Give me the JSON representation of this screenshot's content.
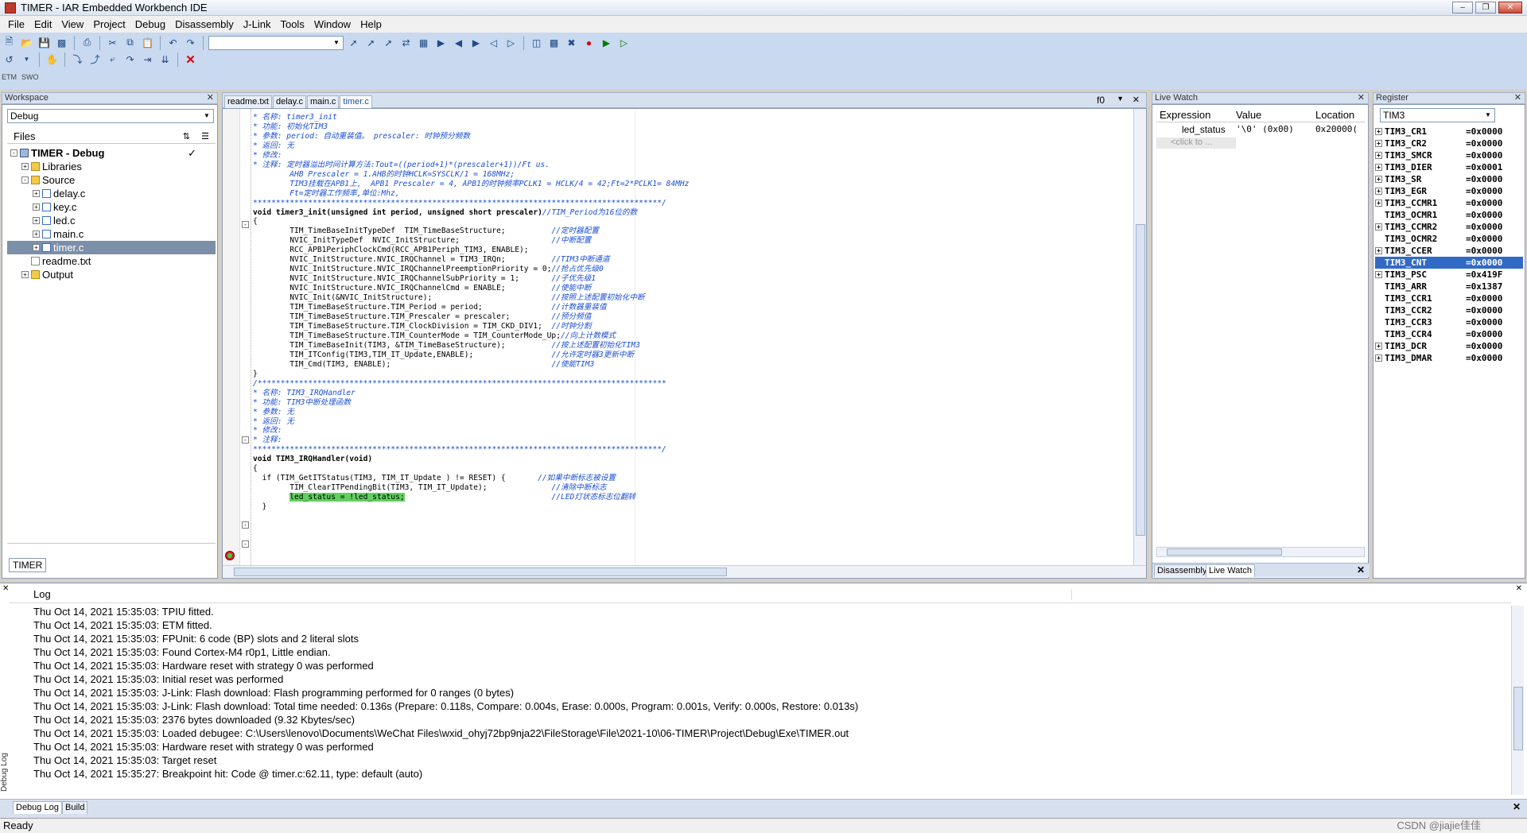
{
  "window": {
    "title": "TIMER - IAR Embedded Workbench IDE"
  },
  "menu": [
    "File",
    "Edit",
    "View",
    "Project",
    "Debug",
    "Disassembly",
    "J-Link",
    "Tools",
    "Window",
    "Help"
  ],
  "small_toolbar_labels": [
    "ETM",
    "SWO"
  ],
  "workspace": {
    "header": "Workspace",
    "config": "Debug",
    "files_label": "Files",
    "tree": [
      {
        "label": "TIMER - Debug",
        "level": 0,
        "kind": "project",
        "check": "✓"
      },
      {
        "label": "Libraries",
        "level": 1,
        "kind": "folder"
      },
      {
        "label": "Source",
        "level": 1,
        "kind": "folder"
      },
      {
        "label": "delay.c",
        "level": 2,
        "kind": "c"
      },
      {
        "label": "key.c",
        "level": 2,
        "kind": "c"
      },
      {
        "label": "led.c",
        "level": 2,
        "kind": "c"
      },
      {
        "label": "main.c",
        "level": 2,
        "kind": "c"
      },
      {
        "label": "timer.c",
        "level": 2,
        "kind": "c",
        "selected": true
      },
      {
        "label": "readme.txt",
        "level": 1,
        "kind": "txt"
      },
      {
        "label": "Output",
        "level": 1,
        "kind": "folder"
      }
    ],
    "bottom_tab": "TIMER"
  },
  "editor": {
    "tabs": [
      "readme.txt",
      "delay.c",
      "main.c",
      "timer.c"
    ],
    "active_tab": "timer.c",
    "func_dropdown": "f0",
    "lines": [
      "* 名称: timer3_init",
      "* 功能: 初始化TIM3",
      "* 参数: period: 自动重装值。 prescaler: 时钟预分频数",
      "* 返回: 无",
      "* 修改:",
      "* 注释: 定时器溢出时间计算方法:Tout=((period+1)*(prescaler+1))/Ft us.",
      "        AHB Prescaler = 1.AHB的时钟HCLK=SYSCLK/1 = 168MHz;",
      "        TIM3挂载在APB1上,  APB1 Prescaler = 4, APB1的时钟频率PCLK1 = HCLK/4 = 42;Ft=2*PCLK1= 84MHz",
      "        Ft=定时器工作频率,单位:Mhz,",
      "*****************************************************************************************/",
      "void timer3_init(unsigned int period, unsigned short prescaler)//TIM_Period为16位的数",
      "{",
      "",
      "        TIM_TimeBaseInitTypeDef  TIM_TimeBaseStructure;          //定时器配置",
      "        NVIC_InitTypeDef  NVIC_InitStructure;                    //中断配置",
      "",
      "        RCC_APB1PeriphClockCmd(RCC_APB1Periph_TIM3, ENABLE);",
      "        NVIC_InitStructure.NVIC_IRQChannel = TIM3_IRQn;          //TIM3中断通道",
      "        NVIC_InitStructure.NVIC_IRQChannelPreemptionPriority = 0;//抢占优先级0",
      "        NVIC_InitStructure.NVIC_IRQChannelSubPriority = 1;       //子优先级1",
      "        NVIC_InitStructure.NVIC_IRQChannelCmd = ENABLE;          //使能中断",
      "",
      "        NVIC_Init(&NVIC_InitStructure);                          //按照上述配置初始化中断",
      "",
      "        TIM_TimeBaseStructure.TIM_Period = period;               //计数器重装值",
      "        TIM_TimeBaseStructure.TIM_Prescaler = prescaler;         //预分频值",
      "        TIM_TimeBaseStructure.TIM_ClockDivision = TIM_CKD_DIV1;  //时钟分割",
      "        TIM_TimeBaseStructure.TIM_CounterMode = TIM_CounterMode_Up;//向上计数模式",
      "        TIM_TimeBaseInit(TIM3, &TIM_TimeBaseStructure);          //按上述配置初始化TIM3",
      "",
      "        TIM_ITConfig(TIM3,TIM_IT_Update,ENABLE);                 //允许定时器3更新中断",
      "        TIM_Cmd(TIM3, ENABLE);                                   //使能TIM3",
      "",
      "}",
      "",
      "",
      "/*****************************************************************************************",
      "* 名称: TIM3_IRQHandler",
      "* 功能: TIM3中断处理函数",
      "* 参数: 无",
      "* 返回: 无",
      "* 修改:",
      "* 注释:",
      "*****************************************************************************************/",
      "void TIM3_IRQHandler(void)",
      "{",
      "  if (TIM_GetITStatus(TIM3, TIM_IT_Update ) != RESET) {       //如果中断标志被设置",
      "        TIM_ClearITPendingBit(TIM3, TIM_IT_Update);              //清除中断标志",
      "        led_status = !led_status;                                //LED灯状态标志位翻转",
      "  }"
    ],
    "highlight_text": "led_status = !led_status;"
  },
  "livewatch": {
    "header": "Live Watch",
    "columns": [
      "Expression",
      "Value",
      "Location"
    ],
    "rows": [
      {
        "expr": "led_status",
        "value": "'\\0' (0x00)",
        "loc": "0x20000("
      }
    ],
    "placeholder": "<click to ...",
    "bottom_tabs": [
      "Disassembly",
      "Live Watch"
    ]
  },
  "register": {
    "header": "Register",
    "group": "TIM3",
    "rows": [
      {
        "name": "TIM3_CR1",
        "value": "0x0000",
        "expand": true
      },
      {
        "name": "TIM3_CR2",
        "value": "0x0000",
        "expand": true
      },
      {
        "name": "TIM3_SMCR",
        "value": "0x0000",
        "expand": true
      },
      {
        "name": "TIM3_DIER",
        "value": "0x0001",
        "expand": true
      },
      {
        "name": "TIM3_SR",
        "value": "0x0000",
        "expand": true
      },
      {
        "name": "TIM3_EGR",
        "value": "0x0000",
        "expand": true
      },
      {
        "name": "TIM3_CCMR1",
        "value": "0x0000",
        "expand": true
      },
      {
        "name": "TIM3_OCMR1",
        "value": "0x0000",
        "expand": false
      },
      {
        "name": "TIM3_CCMR2",
        "value": "0x0000",
        "expand": true
      },
      {
        "name": "TIM3_OCMR2",
        "value": "0x0000",
        "expand": false
      },
      {
        "name": "TIM3_CCER",
        "value": "0x0000",
        "expand": true
      },
      {
        "name": "TIM3_CNT",
        "value": "0x0000",
        "expand": false,
        "selected": true
      },
      {
        "name": "TIM3_PSC",
        "value": "0x419F",
        "expand": true
      },
      {
        "name": "TIM3_ARR",
        "value": "0x1387",
        "expand": false
      },
      {
        "name": "TIM3_CCR1",
        "value": "0x0000",
        "expand": false
      },
      {
        "name": "TIM3_CCR2",
        "value": "0x0000",
        "expand": false
      },
      {
        "name": "TIM3_CCR3",
        "value": "0x0000",
        "expand": false
      },
      {
        "name": "TIM3_CCR4",
        "value": "0x0000",
        "expand": false
      },
      {
        "name": "TIM3_DCR",
        "value": "0x0000",
        "expand": true
      },
      {
        "name": "TIM3_DMAR",
        "value": "0x0000",
        "expand": true
      }
    ]
  },
  "log": {
    "column": "Log",
    "side_label": "Debug Log",
    "tabs": [
      "Debug Log",
      "Build"
    ],
    "lines": [
      "Thu Oct 14, 2021 15:35:03: TPIU fitted.",
      "Thu Oct 14, 2021 15:35:03: ETM fitted.",
      "Thu Oct 14, 2021 15:35:03: FPUnit: 6 code (BP) slots and 2 literal slots",
      "Thu Oct 14, 2021 15:35:03: Found Cortex-M4 r0p1, Little endian.",
      "Thu Oct 14, 2021 15:35:03: Hardware reset with strategy 0 was performed",
      "Thu Oct 14, 2021 15:35:03: Initial reset was performed",
      "Thu Oct 14, 2021 15:35:03: J-Link: Flash download: Flash programming performed for 0 ranges (0 bytes)",
      "Thu Oct 14, 2021 15:35:03: J-Link: Flash download: Total time needed: 0.136s (Prepare: 0.118s, Compare: 0.004s, Erase: 0.000s, Program: 0.001s, Verify: 0.000s, Restore: 0.013s)",
      "Thu Oct 14, 2021 15:35:03: 2376 bytes downloaded (9.32 Kbytes/sec)",
      "Thu Oct 14, 2021 15:35:03: Loaded debugee: C:\\Users\\lenovo\\Documents\\WeChat Files\\wxid_ohyj72bp9nja22\\FileStorage\\File\\2021-10\\06-TIMER\\Project\\Debug\\Exe\\TIMER.out",
      "Thu Oct 14, 2021 15:35:03: Hardware reset with strategy 0 was performed",
      "Thu Oct 14, 2021 15:35:03: Target reset",
      "Thu Oct 14, 2021 15:35:27: Breakpoint hit: Code @ timer.c:62.11, type: default (auto)"
    ]
  },
  "status": {
    "text": "Ready"
  },
  "watermark": "CSDN @jiajie佳佳"
}
